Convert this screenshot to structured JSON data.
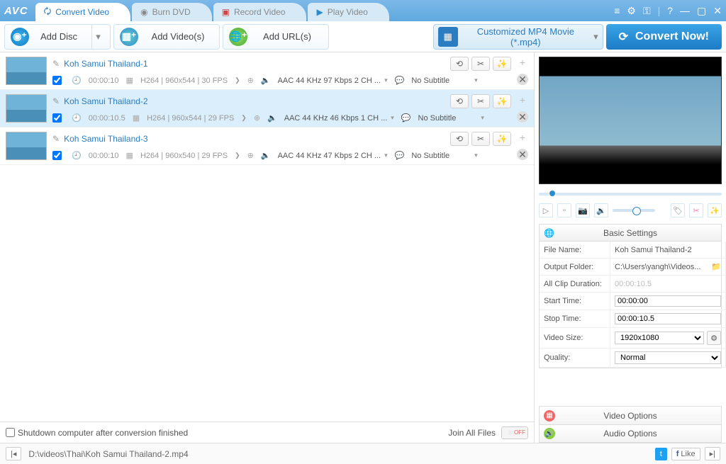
{
  "app": {
    "logo": "AVC"
  },
  "tabs": [
    {
      "label": "Convert Video",
      "icon": "convert-icon",
      "active": true
    },
    {
      "label": "Burn DVD",
      "icon": "disc-icon",
      "active": false
    },
    {
      "label": "Record Video",
      "icon": "record-icon",
      "active": false
    },
    {
      "label": "Play Video",
      "icon": "play-icon",
      "active": false
    }
  ],
  "toolbar": {
    "add_disc": "Add Disc",
    "add_videos": "Add Video(s)",
    "add_urls": "Add URL(s)",
    "profile": "Customized MP4 Movie (*.mp4)",
    "convert": "Convert Now!"
  },
  "files": [
    {
      "title": "Koh Samui Thailand-1",
      "checked": true,
      "duration": "00:00:10",
      "codec": "H264",
      "res": "960x544",
      "fps": "30 FPS",
      "audio": "AAC 44 KHz 97 Kbps 2 CH ...",
      "subtitle": "No Subtitle",
      "selected": false
    },
    {
      "title": "Koh Samui Thailand-2",
      "checked": true,
      "duration": "00:00:10.5",
      "codec": "H264",
      "res": "960x544",
      "fps": "29 FPS",
      "audio": "AAC 44 KHz 46 Kbps 1 CH ...",
      "subtitle": "No Subtitle",
      "selected": true
    },
    {
      "title": "Koh Samui Thailand-3",
      "checked": true,
      "duration": "00:00:10",
      "codec": "H264",
      "res": "960x540",
      "fps": "29 FPS",
      "audio": "AAC 44 KHz 47 Kbps 2 CH ...",
      "subtitle": "No Subtitle",
      "selected": false
    }
  ],
  "bottom": {
    "shutdown": "Shutdown computer after conversion finished",
    "join": "Join All Files",
    "join_state": "OFF"
  },
  "statusbar": {
    "path": "D:\\videos\\Thai\\Koh Samui Thailand-2.mp4",
    "like": "Like"
  },
  "settings": {
    "header": "Basic Settings",
    "rows": {
      "file_name_label": "File Name:",
      "file_name": "Koh Samui Thailand-2",
      "output_label": "Output Folder:",
      "output": "C:\\Users\\yangh\\Videos...",
      "clip_label": "All Clip Duration:",
      "clip": "00:00:10.5",
      "start_label": "Start Time:",
      "start": "00:00:00",
      "stop_label": "Stop Time:",
      "stop": "00:00:10.5",
      "size_label": "Video Size:",
      "size": "1920x1080",
      "quality_label": "Quality:",
      "quality": "Normal"
    },
    "video_options": "Video Options",
    "audio_options": "Audio Options"
  }
}
